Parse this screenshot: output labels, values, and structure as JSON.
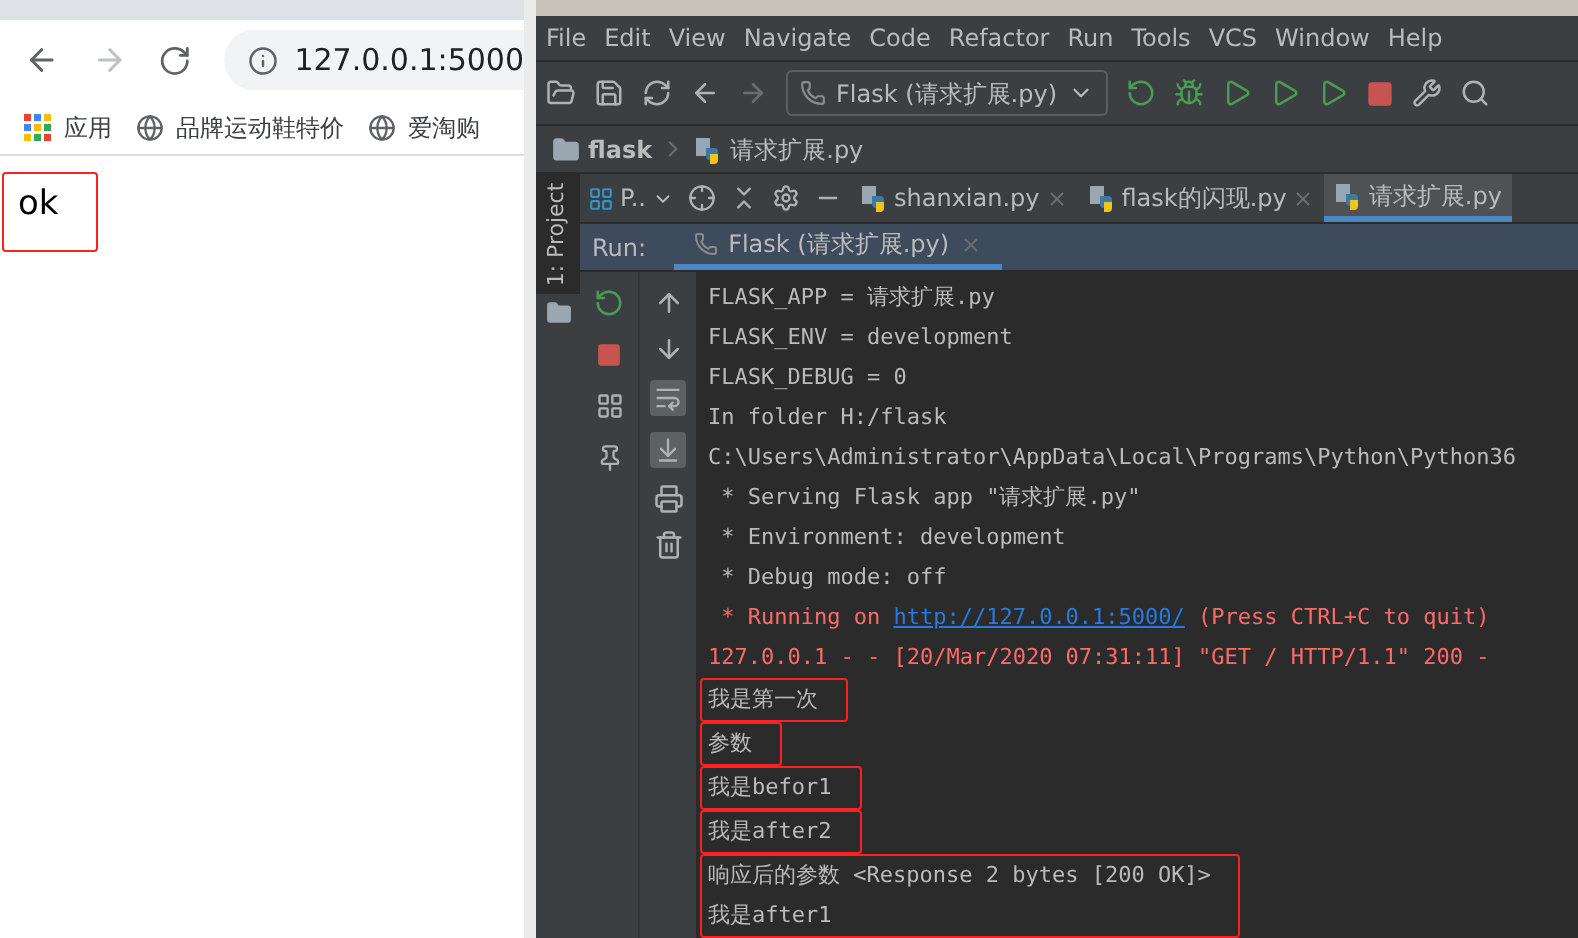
{
  "browser": {
    "address": "127.0.0.1:5000",
    "bookmarks": [
      {
        "kind": "apps",
        "label": "应用"
      },
      {
        "kind": "site",
        "label": "品牌运动鞋特价"
      },
      {
        "kind": "site",
        "label": "爱淘购"
      }
    ],
    "page_text": "ok"
  },
  "ide": {
    "menu": [
      "File",
      "Edit",
      "View",
      "Navigate",
      "Code",
      "Refactor",
      "Run",
      "Tools",
      "VCS",
      "Window",
      "Help"
    ],
    "run_config": "Flask (请求扩展.py)",
    "breadcrumb": [
      "flask",
      "请求扩展.py"
    ],
    "project_panel": {
      "label": "P..",
      "stripe_label": "1: Project"
    },
    "tabs": [
      {
        "label": "shanxian.py",
        "selected": false
      },
      {
        "label": "flask的闪现.py",
        "selected": false
      },
      {
        "label": "请求扩展.py",
        "selected": true
      }
    ],
    "run": {
      "label": "Run:",
      "tab": "Flask (请求扩展.py)",
      "blocks": [
        {
          "outlined": false,
          "lines": [
            [
              {
                "kind": "normal",
                "text": "FLASK_APP = 请求扩展.py"
              }
            ],
            [
              {
                "kind": "normal",
                "text": "FLASK_ENV = development"
              }
            ],
            [
              {
                "kind": "normal",
                "text": "FLASK_DEBUG = 0"
              }
            ],
            [
              {
                "kind": "normal",
                "text": "In folder H:/flask"
              }
            ],
            [
              {
                "kind": "normal",
                "text": "C:\\Users\\Administrator\\AppData\\Local\\Programs\\Python\\Python36"
              }
            ],
            [
              {
                "kind": "normal",
                "text": " * Serving Flask app \"请求扩展.py\""
              }
            ],
            [
              {
                "kind": "normal",
                "text": " * Environment: development"
              }
            ],
            [
              {
                "kind": "normal",
                "text": " * Debug mode: off"
              }
            ],
            [
              {
                "kind": "error",
                "text": " * Running on "
              },
              {
                "kind": "link",
                "text": "http://127.0.0.1:5000/"
              },
              {
                "kind": "error",
                "text": " (Press CTRL+C to quit)"
              }
            ],
            [
              {
                "kind": "error",
                "text": "127.0.0.1 - - [20/Mar/2020 07:31:11] \"GET / HTTP/1.1\" 200 -"
              }
            ]
          ]
        },
        {
          "outlined": true,
          "lines": [
            [
              {
                "kind": "normal",
                "text": "我是第一次"
              }
            ]
          ]
        },
        {
          "outlined": true,
          "lines": [
            [
              {
                "kind": "normal",
                "text": "参数"
              }
            ]
          ]
        },
        {
          "outlined": true,
          "lines": [
            [
              {
                "kind": "normal",
                "text": "我是befor1"
              }
            ]
          ]
        },
        {
          "outlined": true,
          "lines": [
            [
              {
                "kind": "normal",
                "text": "我是after2"
              }
            ]
          ]
        },
        {
          "outlined": true,
          "lines": [
            [
              {
                "kind": "normal",
                "text": "响应后的参数 <Response 2 bytes [200 OK]>"
              }
            ],
            [
              {
                "kind": "normal",
                "text": "我是after1"
              }
            ]
          ]
        }
      ]
    }
  }
}
